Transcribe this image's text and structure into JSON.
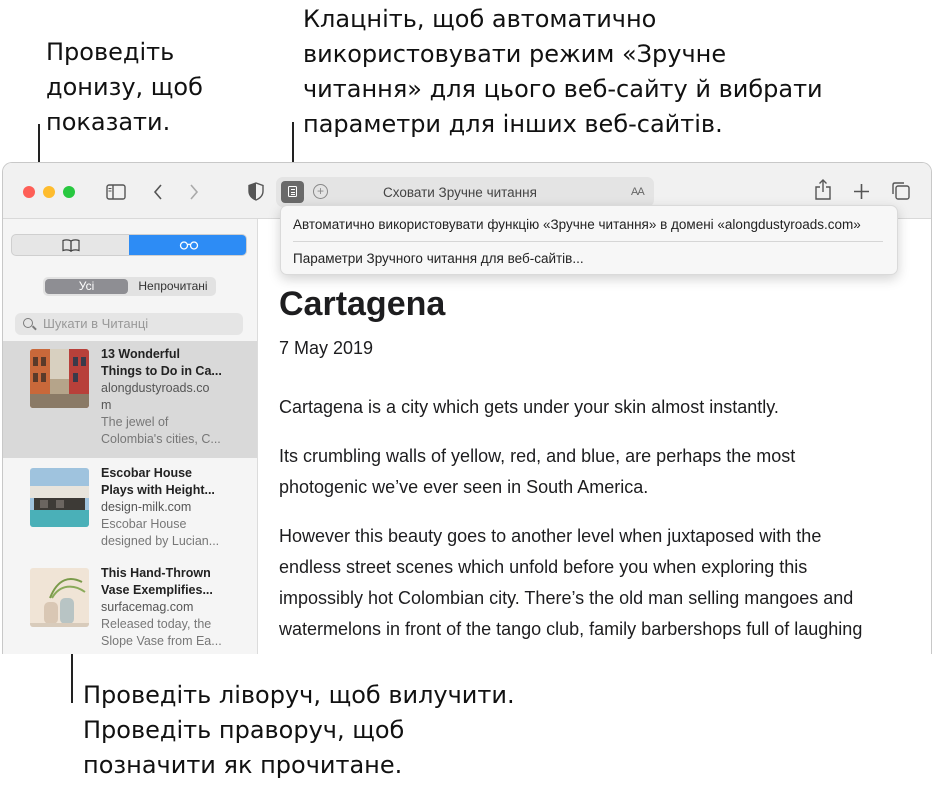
{
  "callouts": {
    "swipe_down": [
      "Проведіть",
      "донизу, щоб",
      "показати."
    ],
    "reader_click": [
      "Клацніть, щоб автоматично",
      "використовувати режим «Зручне",
      "читання» для цього веб-сайту й вибрати",
      "параметри для інших веб-сайтів."
    ],
    "swipe_left": [
      "Проведіть ліворуч, щоб вилучити.",
      "Проведіть праворуч, щоб",
      "позначити як прочитане."
    ]
  },
  "toolbar": {
    "url_text": "Сховати Зручне читання",
    "text_size_label": "AA",
    "traffic_colors": {
      "close": "#fe5f57",
      "minimize": "#febc2e",
      "zoom": "#28c840"
    }
  },
  "reader_menu": {
    "items": [
      "Автоматично використовувати функцію «Зручне читання» в домені «alongdustyroads.com»",
      "Параметри Зручного читання для веб-сайтів..."
    ]
  },
  "sidebar": {
    "tabs": [
      "bookmarks",
      "reading-list"
    ],
    "active_tab": "reading-list",
    "filter": {
      "all": "Усі",
      "unread": "Непрочитані",
      "selected": "Усі"
    },
    "search_placeholder": "Шукати в Читанці",
    "items": [
      {
        "title": [
          "13 Wonderful",
          "Things to Do in Ca..."
        ],
        "domain": [
          "alongdustyroads.co",
          "m"
        ],
        "excerpt": [
          "The jewel of",
          "Colombia's cities, C..."
        ],
        "selected": true
      },
      {
        "title": [
          "Escobar House",
          "Plays with Height..."
        ],
        "domain": [
          "design-milk.com"
        ],
        "excerpt": [
          "Escobar House",
          "designed by Lucian..."
        ],
        "selected": false
      },
      {
        "title": [
          "This Hand-Thrown",
          "Vase Exemplifies..."
        ],
        "domain": [
          "surfacemag.com"
        ],
        "excerpt": [
          "Released today, the",
          "Slope Vase from Ea..."
        ],
        "selected": false
      }
    ]
  },
  "article": {
    "title": "Cartagena",
    "date": "7 May 2019",
    "paragraphs": [
      [
        "Cartagena is a city which gets under your skin almost instantly."
      ],
      [
        "Its crumbling walls of yellow, red, and blue, are perhaps the most",
        "photogenic we’ve ever seen in South America."
      ],
      [
        "However this beauty goes to another level when juxtaposed with the",
        "endless street scenes which unfold before you when exploring this",
        "impossibly hot Colombian city. There’s the old man selling mangoes and",
        "watermelons in front of the tango club, family barbershops full of laughing"
      ]
    ]
  },
  "colors": {
    "accent": "#2d8cf5",
    "selected_row": "#d9d9d9"
  }
}
